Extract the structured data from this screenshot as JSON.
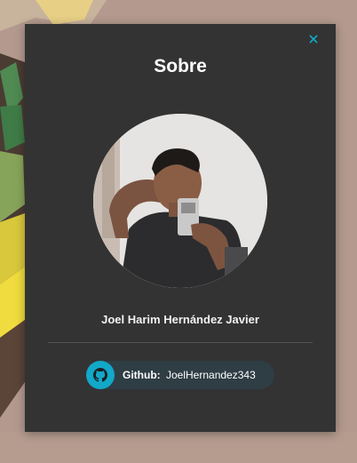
{
  "modal": {
    "title": "Sobre",
    "close_icon": "close-icon",
    "name": "Joel Harim Hernández Javier",
    "github": {
      "label": "Github:",
      "username": "JoelHernandez343",
      "icon": "github-icon"
    }
  },
  "colors": {
    "modal_bg": "#333333",
    "accent": "#12a8c7",
    "chip_bg": "#2f3d45",
    "page_bg": "#b49a8e"
  }
}
